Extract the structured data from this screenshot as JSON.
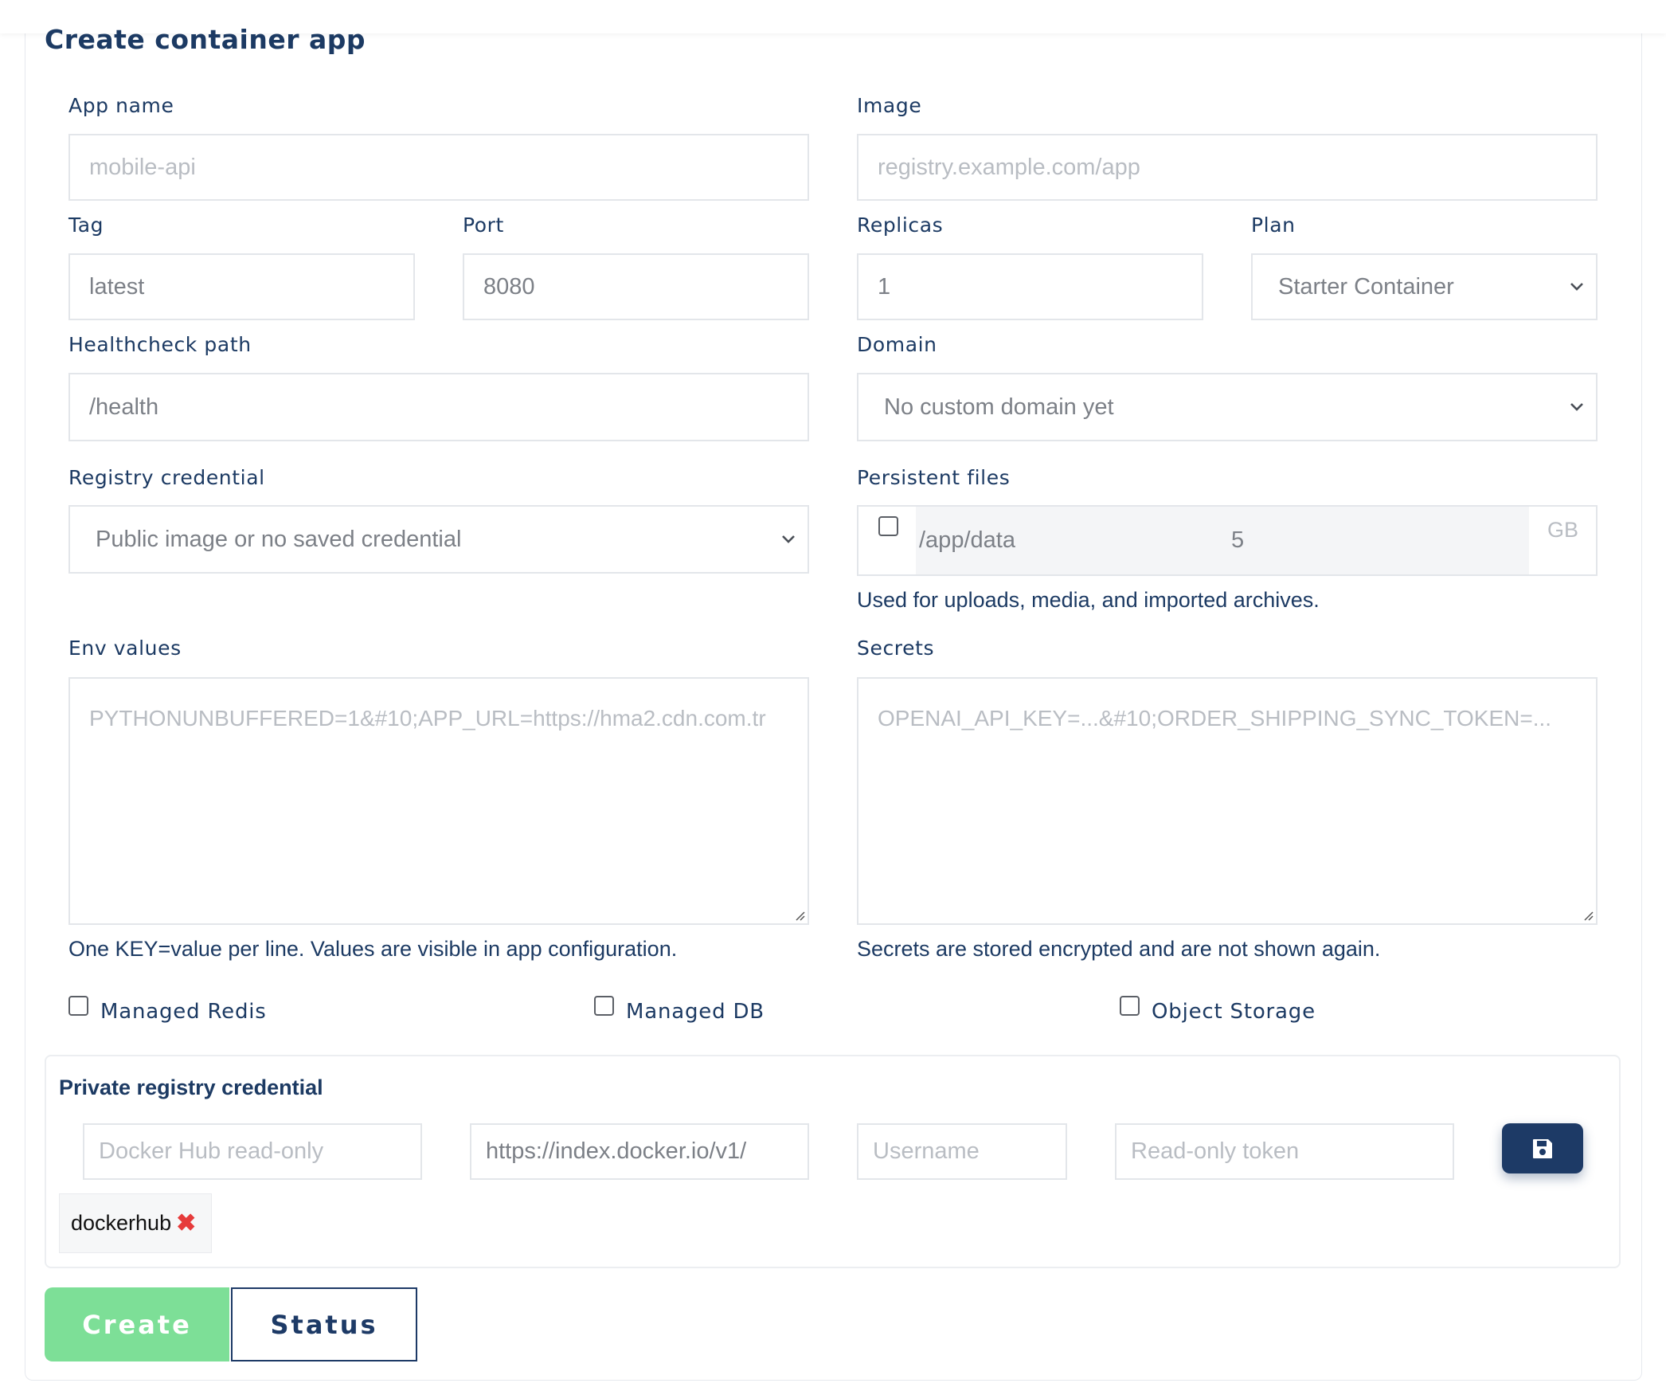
{
  "page": {
    "title": "Create container app"
  },
  "form": {
    "app_name": {
      "label": "App name",
      "placeholder": "mobile-api"
    },
    "image": {
      "label": "Image",
      "placeholder": "registry.example.com/app"
    },
    "tag": {
      "label": "Tag",
      "value": "latest"
    },
    "port": {
      "label": "Port",
      "value": "8080"
    },
    "replicas": {
      "label": "Replicas",
      "value": "1"
    },
    "plan": {
      "label": "Plan",
      "selected": "Starter Container"
    },
    "healthcheck": {
      "label": "Healthcheck path",
      "value": "/health"
    },
    "domain": {
      "label": "Domain",
      "selected": "No custom domain yet"
    },
    "registry_credential": {
      "label": "Registry credential",
      "selected": "Public image or no saved credential"
    },
    "persistent_files": {
      "label": "Persistent files",
      "path": "/app/data",
      "size": "5",
      "unit": "GB",
      "help": "Used for uploads, media, and imported archives."
    },
    "env": {
      "label": "Env values",
      "placeholder": "PYTHONUNBUFFERED=1&#10;APP_URL=https://hma2.cdn.com.tr",
      "help": "One KEY=value per line. Values are visible in app configuration."
    },
    "secrets": {
      "label": "Secrets",
      "placeholder": "OPENAI_API_KEY=...&#10;ORDER_SHIPPING_SYNC_TOKEN=...",
      "help": "Secrets are stored encrypted and are not shown again."
    },
    "addons": [
      {
        "label": "Managed Redis",
        "checked": false
      },
      {
        "label": "Managed DB",
        "checked": false
      },
      {
        "label": "Object Storage",
        "checked": false
      }
    ]
  },
  "private_registry": {
    "title": "Private registry credential",
    "name_placeholder": "Docker Hub read-only",
    "server_value": "https://index.docker.io/v1/",
    "username_placeholder": "Username",
    "token_placeholder": "Read-only token",
    "save_icon": "save-icon",
    "saved": [
      {
        "name": "dockerhub",
        "remove_icon": "✖"
      }
    ]
  },
  "actions": {
    "create_label": "Create",
    "status_label": "Status"
  },
  "colors": {
    "primary": "#1d3a66",
    "success": "#7ddf97",
    "danger": "#e63b3b",
    "text": "#1c3a63"
  }
}
